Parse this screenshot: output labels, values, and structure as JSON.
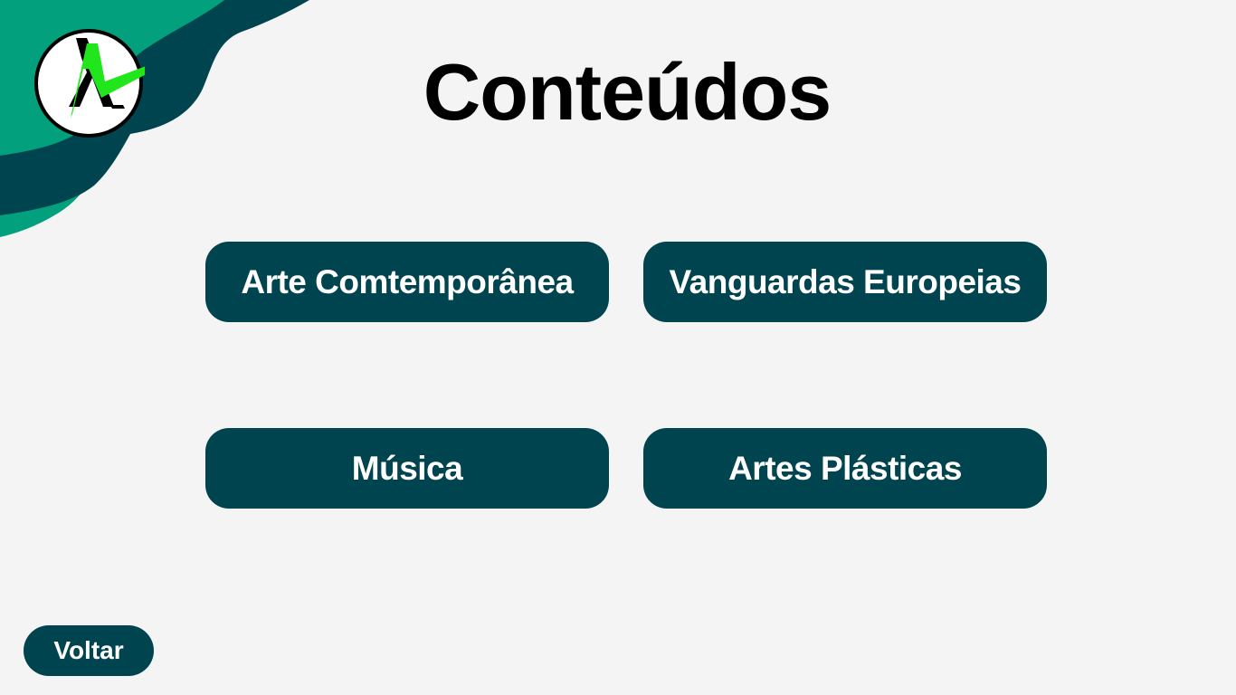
{
  "page": {
    "title": "Conteúdos"
  },
  "logo": {
    "icon": "letter-a-checkmark-logo",
    "colors": {
      "ring": "#000000",
      "fill": "#ffffff",
      "letter": "#000000",
      "check": "#22e61c"
    }
  },
  "decoration": {
    "colors": {
      "light": "#02a07c",
      "dark": "#004450"
    }
  },
  "buttons": [
    {
      "label": "Arte Comtemporânea"
    },
    {
      "label": "Vanguardas Europeias"
    },
    {
      "label": "Música"
    },
    {
      "label": "Artes Plásticas"
    }
  ],
  "back": {
    "label": "Voltar"
  },
  "colors": {
    "background": "#f4f4f4",
    "button": "#004450",
    "button_text": "#ffffff",
    "title_text": "#000000"
  }
}
